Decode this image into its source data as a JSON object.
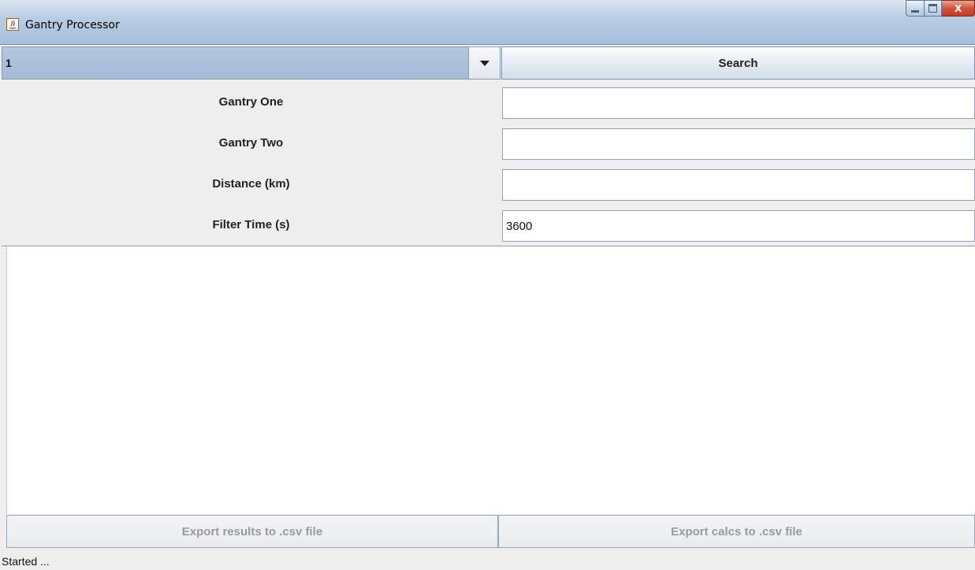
{
  "window": {
    "title": "Gantry Processor",
    "close_glyph": "X"
  },
  "toolbar": {
    "combo_value": "1",
    "search_label": "Search"
  },
  "form": {
    "fields": [
      {
        "label": "Gantry One",
        "value": ""
      },
      {
        "label": "Gantry Two",
        "value": ""
      },
      {
        "label": "Distance (km)",
        "value": ""
      },
      {
        "label": "Filter Time (s)",
        "value": "3600"
      }
    ]
  },
  "actions": {
    "export_results_label": "Export results to .csv file",
    "export_calcs_label": "Export calcs to .csv file"
  },
  "status": {
    "text": "Started ..."
  },
  "icons": {
    "app": "java-app-icon",
    "minimize": "minimize-icon",
    "maximize": "maximize-icon",
    "close": "close-icon",
    "dropdown": "chevron-down-icon"
  },
  "colors": {
    "title_bar": "#b9cde3",
    "combo_bg": "#a4bad6",
    "close_button": "#c23c22",
    "disabled_text": "#9a9a9a"
  }
}
